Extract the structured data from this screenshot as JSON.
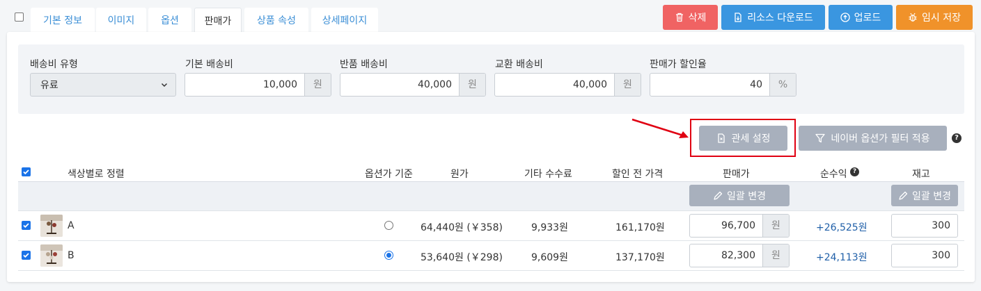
{
  "tabs": [
    {
      "label": "기본 정보",
      "active": false
    },
    {
      "label": "이미지",
      "active": false
    },
    {
      "label": "옵션",
      "active": false
    },
    {
      "label": "판매가",
      "active": true
    },
    {
      "label": "상품 속성",
      "active": false
    },
    {
      "label": "상세페이지",
      "active": false
    }
  ],
  "toolbar": {
    "delete_label": "삭제",
    "download_label": "리소스 다운로드",
    "upload_label": "업로드",
    "save_draft_label": "임시 저장"
  },
  "shipping": {
    "type_label": "배송비 유형",
    "type_value": "유료",
    "base_label": "기본 배송비",
    "base_value": "10,000",
    "return_label": "반품 배송비",
    "return_value": "40,000",
    "exchange_label": "교환 배송비",
    "exchange_value": "40,000",
    "discount_label": "판매가 할인율",
    "discount_value": "40",
    "won_unit": "원",
    "percent_unit": "%"
  },
  "actions": {
    "customs_label": "관세 설정",
    "naver_filter_label": "네이버 옵션가 필터 적용",
    "help": "?"
  },
  "table": {
    "headers": {
      "sort": "색상별로 정렬",
      "option_base": "옵션가 기준",
      "cost": "원가",
      "other_fee": "기타 수수료",
      "pre_discount": "할인 전 가격",
      "price": "판매가",
      "net_profit": "순수익",
      "stock": "재고"
    },
    "bulk_edit_label": "일괄 변경",
    "rows": [
      {
        "name": "A",
        "option_base": false,
        "cost": "64,440원 (￥358)",
        "other_fee": "9,933원",
        "pre_discount": "161,170원",
        "price": "96,700",
        "price_unit": "원",
        "net_profit": "+26,525원",
        "stock": "300"
      },
      {
        "name": "B",
        "option_base": true,
        "cost": "53,640원 (￥298)",
        "other_fee": "9,609원",
        "pre_discount": "137,170원",
        "price": "82,300",
        "price_unit": "원",
        "net_profit": "+24,113원",
        "stock": "300"
      }
    ]
  },
  "colors": {
    "delete": "#f06363",
    "download": "#3a96e0",
    "upload": "#3a96e0",
    "save_draft": "#f0922a",
    "gray_button": "#a8b0bd",
    "highlight": "#e00012",
    "profit": "#1f5fa8"
  }
}
